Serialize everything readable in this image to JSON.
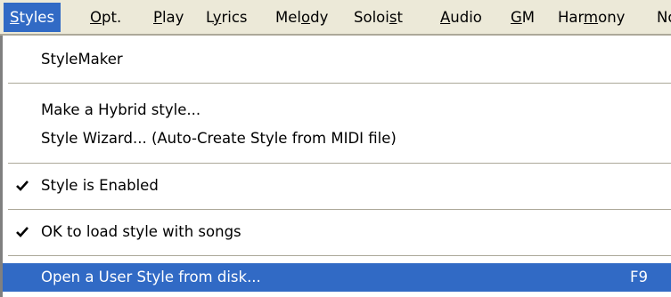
{
  "menubar": {
    "items": [
      {
        "pre": "",
        "ul": "S",
        "post": "tyles"
      },
      {
        "pre": "",
        "ul": "O",
        "post": "pt."
      },
      {
        "pre": "",
        "ul": "P",
        "post": "lay"
      },
      {
        "pre": "L",
        "ul": "y",
        "post": "rics"
      },
      {
        "pre": "Mel",
        "ul": "o",
        "post": "dy"
      },
      {
        "pre": "Soloi",
        "ul": "s",
        "post": "t"
      },
      {
        "pre": "",
        "ul": "A",
        "post": "udio"
      },
      {
        "pre": "",
        "ul": "G",
        "post": "M"
      },
      {
        "pre": "Har",
        "ul": "m",
        "post": "ony"
      },
      {
        "pre": "No",
        "ul": "",
        "post": ""
      }
    ]
  },
  "dropdown": {
    "stylemaker": "StyleMaker",
    "hybrid": "Make a Hybrid style...",
    "wizard": "Style Wizard... (Auto-Create Style from MIDI file)",
    "enabled": "Style is Enabled",
    "ok_load": "OK to load style with songs",
    "open_user": "Open a User Style from disk...",
    "open_user_shortcut": "F9"
  },
  "colors": {
    "highlight": "#316ac5",
    "menubar_bg": "#ece9d8"
  },
  "icons": {
    "checkmark": "check-icon"
  }
}
